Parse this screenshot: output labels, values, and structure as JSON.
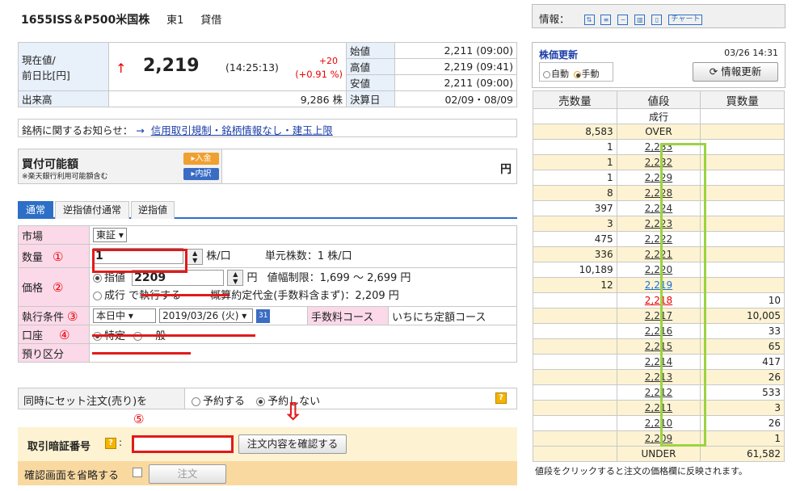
{
  "header": {
    "name": "1655ISS＆P500米国株",
    "market": "東1",
    "type": "貸借"
  },
  "price": {
    "label": "現在値/\n前日比[円]",
    "arrow": "↑",
    "current": "2,219",
    "time": "(14:25:13)",
    "change": "+20",
    "change_pct": "(+0.91 %)",
    "volume_label": "出来高",
    "volume": "9,286 株",
    "stats": [
      {
        "label": "始値",
        "value": "2,211 (09:00)"
      },
      {
        "label": "高値",
        "value": "2,219 (09:41)"
      },
      {
        "label": "安値",
        "value": "2,211 (09:00)"
      },
      {
        "label": "決算日",
        "value": "02/09・08/09"
      }
    ]
  },
  "notice": {
    "label": "銘柄に関するお知らせ：",
    "arrow": "→",
    "link": "信用取引規制・銘柄情報なし・建玉上限"
  },
  "buying_power": {
    "title": "買付可能額",
    "note": "※楽天銀行利用可能額含む",
    "deposit": "▸入金",
    "detail": "▸内訳",
    "unit": "円"
  },
  "tabs": [
    "通常",
    "逆指値付通常",
    "逆指値"
  ],
  "form": {
    "market_label": "市場",
    "market_value": "東証",
    "qty_label": "数量",
    "qty_mark": "①",
    "qty_value": "1",
    "qty_unit": "株/口",
    "unit_shares": "単元株数：1 株/口",
    "price_label": "価格",
    "price_mark": "②",
    "limit": "指値",
    "price_value": "2209",
    "price_unit": "円",
    "price_range": "値幅制限：1,699 〜 2,699 円",
    "market_order": "成行 で執行する",
    "estimate": "概算約定代金(手数料含まず)：2,209 円",
    "cond_label": "執行条件",
    "cond_mark": "③",
    "cond_value": "本日中",
    "date_value": "2019/03/26 (火)",
    "fee_label": "手数料コース",
    "fee_value": "いちにち定額コース",
    "account_label": "口座",
    "account_mark": "④",
    "acc_specific": "特定",
    "acc_general": "一般",
    "custody_label": "預り区分",
    "custody_value": "-"
  },
  "set_order": {
    "label": "同時にセット注文(売り)を",
    "yes": "予約する",
    "no": "予約しない",
    "help": "?"
  },
  "pin": {
    "mark": "⑤",
    "label": "取引暗証番号",
    "help": "?",
    "confirm": "注文内容を確認する",
    "arrow": "⇩"
  },
  "skip": {
    "label": "確認画面を省略する",
    "order": "注文"
  },
  "info_bar": {
    "label": "情報：",
    "chart": "チャート"
  },
  "update": {
    "title": "株価更新",
    "time": "03/26 14:31",
    "auto": "自動",
    "manual": "手動",
    "refresh": "情報更新"
  },
  "book": {
    "headers": [
      "売数量",
      "値段",
      "買数量"
    ],
    "market": "成行",
    "over_qty": "8,583",
    "over": "OVER",
    "rows": [
      {
        "s": "1",
        "p": "2,233",
        "b": ""
      },
      {
        "s": "1",
        "p": "2,232",
        "b": ""
      },
      {
        "s": "1",
        "p": "2,229",
        "b": ""
      },
      {
        "s": "8",
        "p": "2,228",
        "b": ""
      },
      {
        "s": "397",
        "p": "2,224",
        "b": ""
      },
      {
        "s": "3",
        "p": "2,223",
        "b": ""
      },
      {
        "s": "475",
        "p": "2,222",
        "b": ""
      },
      {
        "s": "336",
        "p": "2,221",
        "b": ""
      },
      {
        "s": "10,189",
        "p": "2,220",
        "b": ""
      },
      {
        "s": "12",
        "p": "2,219",
        "b": ""
      },
      {
        "s": "",
        "p": "2,218",
        "b": "10"
      },
      {
        "s": "",
        "p": "2,217",
        "b": "10,005"
      },
      {
        "s": "",
        "p": "2,216",
        "b": "33"
      },
      {
        "s": "",
        "p": "2,215",
        "b": "65"
      },
      {
        "s": "",
        "p": "2,214",
        "b": "417"
      },
      {
        "s": "",
        "p": "2,213",
        "b": "26"
      },
      {
        "s": "",
        "p": "2,212",
        "b": "533"
      },
      {
        "s": "",
        "p": "2,211",
        "b": "3"
      },
      {
        "s": "",
        "p": "2,210",
        "b": "26"
      },
      {
        "s": "",
        "p": "2,209",
        "b": "1"
      }
    ],
    "under": "UNDER",
    "under_qty": "61,582",
    "footer": "値段をクリックすると注文の価格欄に反映されます。"
  },
  "colors": {
    "accent_blue": "#2d6fc7",
    "red": "#e21a1a",
    "green": "#9cd341",
    "pink": "#fbd9e9"
  }
}
